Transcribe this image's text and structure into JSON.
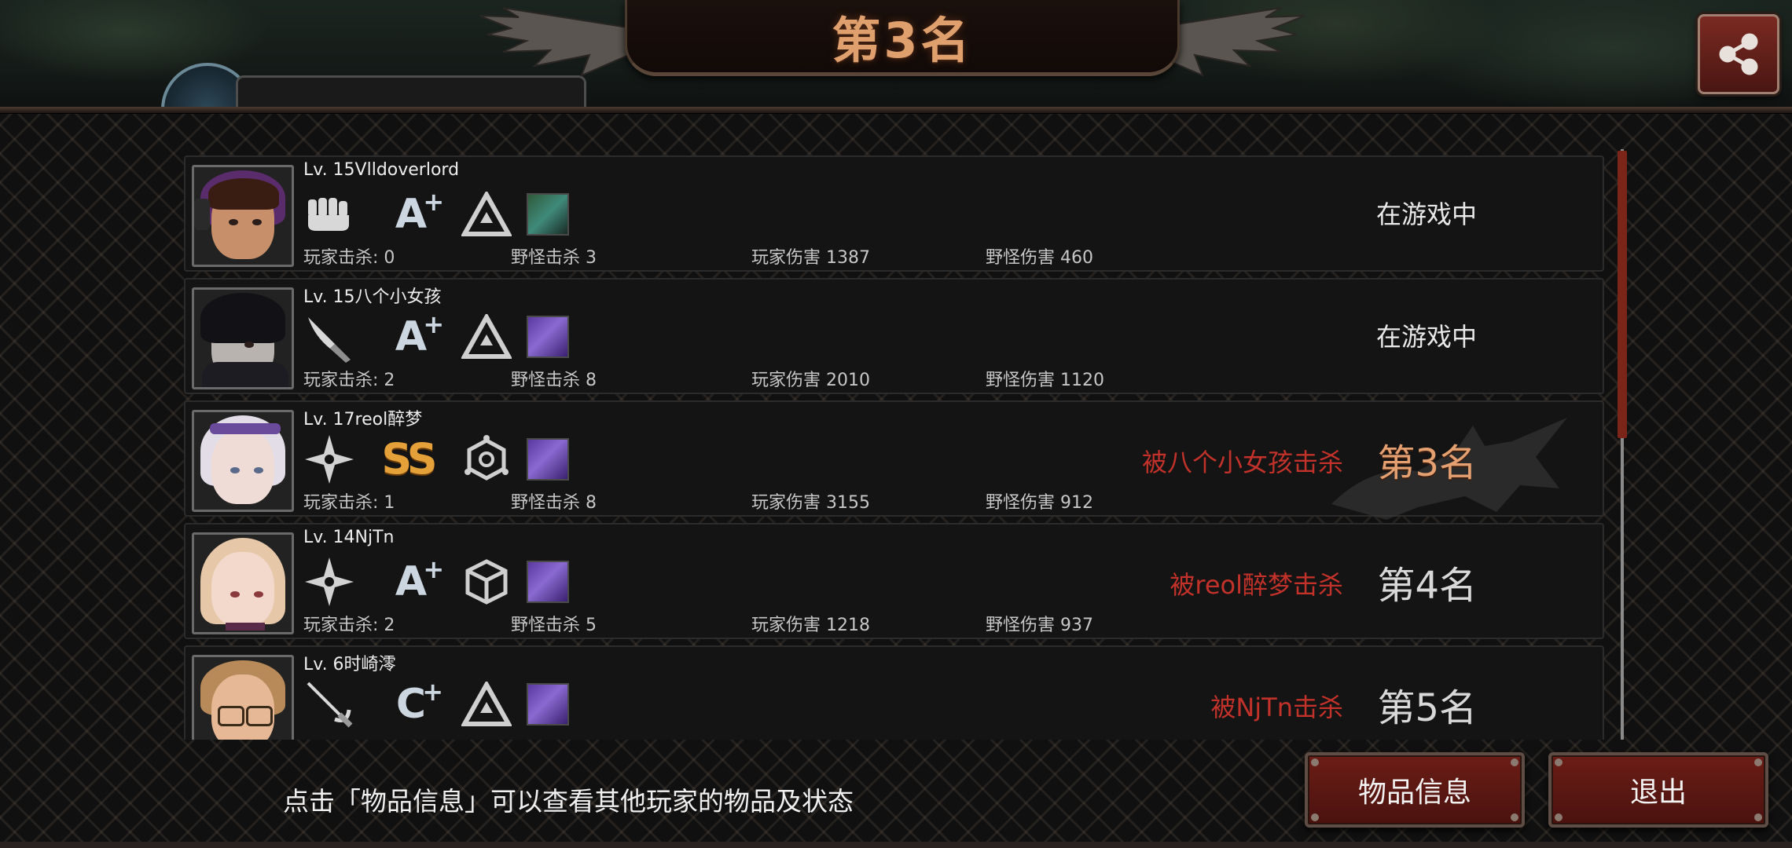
{
  "banner": {
    "title": "第3名"
  },
  "share": {
    "icon": "share-icon"
  },
  "players": [
    {
      "level_name": "Lv. 15Vlldoverlord",
      "weapon_icon": "fist-icon",
      "grade": "A",
      "grade_plus": "+",
      "skill_icon": "triangle-emblem-icon",
      "player_kills": "玩家击杀: 0",
      "monster_kills": "野怪击杀 3",
      "player_damage": "玩家伤害 1387",
      "monster_damage": "野怪伤害 460",
      "status": "在游戏中"
    },
    {
      "level_name": "Lv. 15八个小女孩",
      "weapon_icon": "knife-icon",
      "grade": "A",
      "grade_plus": "+",
      "skill_icon": "triangle-emblem-icon",
      "player_kills": "玩家击杀: 2",
      "monster_kills": "野怪击杀 8",
      "player_damage": "玩家伤害 2010",
      "monster_damage": "野怪伤害 1120",
      "status": "在游戏中"
    },
    {
      "level_name": "Lv. 17reol醉梦",
      "weapon_icon": "shuriken-icon",
      "grade": "SS",
      "grade_plus": "",
      "skill_icon": "hexagon-emblem-icon",
      "player_kills": "玩家击杀: 1",
      "monster_kills": "野怪击杀 8",
      "player_damage": "玩家伤害 3155",
      "monster_damage": "野怪伤害 912",
      "killed_by": "被八个小女孩击杀",
      "place": "第3名"
    },
    {
      "level_name": "Lv. 14NjTn",
      "weapon_icon": "shuriken-icon",
      "grade": "A",
      "grade_plus": "+",
      "skill_icon": "cube-emblem-icon",
      "player_kills": "玩家击杀: 2",
      "monster_kills": "野怪击杀 5",
      "player_damage": "玩家伤害 1218",
      "monster_damage": "野怪伤害 937",
      "killed_by": "被reol醉梦击杀",
      "place": "第4名"
    },
    {
      "level_name": "Lv. 6时崎澪",
      "weapon_icon": "rapier-icon",
      "grade": "C",
      "grade_plus": "+",
      "skill_icon": "triangle-emblem-icon",
      "killed_by": "被NjTn击杀",
      "place": "第5名"
    }
  ],
  "footer": {
    "hint": "点击「物品信息」可以查看其他玩家的物品及状态",
    "item_info_label": "物品信息",
    "exit_label": "退出"
  },
  "colors": {
    "accent_gold": "#e0a06e",
    "kill_red": "#c2322a",
    "button_red": "#6b1d16",
    "scroll_thumb": "#7a2518"
  }
}
